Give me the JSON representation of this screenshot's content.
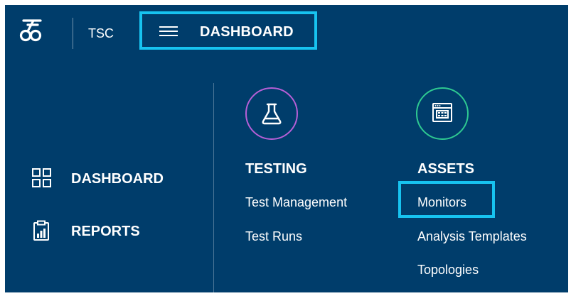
{
  "topbar": {
    "brand": "TSC",
    "menu_title": "DASHBOARD"
  },
  "sidebar": {
    "items": [
      {
        "label": "DASHBOARD",
        "icon": "grid-icon"
      },
      {
        "label": "REPORTS",
        "icon": "report-icon"
      }
    ]
  },
  "sections": {
    "testing": {
      "title": "TESTING",
      "icon": "flask-icon",
      "links": [
        "Test Management",
        "Test Runs"
      ]
    },
    "assets": {
      "title": "ASSETS",
      "icon": "server-window-icon",
      "links": [
        "Monitors",
        "Analysis Templates",
        "Topologies"
      ]
    }
  },
  "colors": {
    "background": "#003d6b",
    "highlight": "#17c3f0",
    "testing_accent": "#b65fd6",
    "assets_accent": "#2ec991",
    "text": "#ffffff"
  }
}
